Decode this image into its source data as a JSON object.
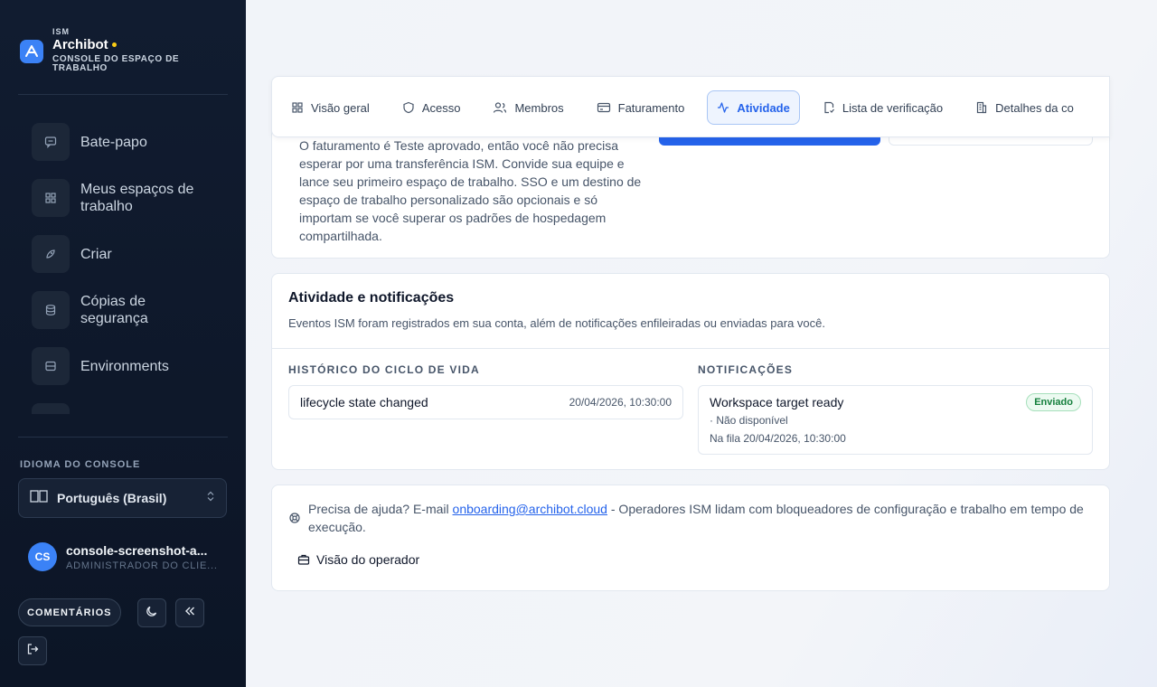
{
  "brand": {
    "kicker": "ISM",
    "name": "Archibot",
    "subtitle": "CONSOLE DO ESPAÇO DE TRABALHO"
  },
  "sidebar": {
    "items": [
      {
        "label": "Bate-papo",
        "icon": "chat-icon"
      },
      {
        "label": "Meus espaços de trabalho",
        "icon": "grid-icon"
      },
      {
        "label": "Criar",
        "icon": "rocket-icon"
      },
      {
        "label": "Cópias de segurança",
        "icon": "database-icon"
      },
      {
        "label": "Environments",
        "icon": "server-icon"
      }
    ],
    "language_title": "IDIOMA DO CONSOLE",
    "language_value": "Português (Brasil)",
    "user": {
      "initials": "CS",
      "name": "console-screenshot-a...",
      "role": "ADMINISTRADOR DO CLIE..."
    },
    "feedback_label": "COMENTÁRIOS"
  },
  "tabs": [
    {
      "label": "Visão geral",
      "icon": "grid-icon",
      "active": false
    },
    {
      "label": "Acesso",
      "icon": "shield-icon",
      "active": false
    },
    {
      "label": "Membros",
      "icon": "users-icon",
      "active": false
    },
    {
      "label": "Faturamento",
      "icon": "credit-card-icon",
      "active": false
    },
    {
      "label": "Atividade",
      "icon": "activity-icon",
      "active": true
    },
    {
      "label": "Lista de verificação",
      "icon": "checklist-icon",
      "active": false
    },
    {
      "label": "Detalhes da co",
      "icon": "building-icon",
      "active": false
    }
  ],
  "intro": {
    "text": "O faturamento é Teste aprovado, então você não precisa esperar por uma transferência ISM. Convide sua equipe e lance seu primeiro espaço de trabalho. SSO e um destino de espaço de trabalho personalizado são opcionais e só importam se você superar os padrões de hospedagem compartilhada."
  },
  "activity": {
    "title": "Atividade e notificações",
    "description": "Eventos ISM foram registrados em sua conta, além de notificações enfileiradas ou enviadas para você.",
    "lifecycle_title": "HISTÓRICO DO CICLO DE VIDA",
    "lifecycle_items": [
      {
        "label": "lifecycle state changed",
        "time": "20/04/2026, 10:30:00"
      }
    ],
    "notifications_title": "NOTIFICAÇÕES",
    "notifications": [
      {
        "title": "Workspace target ready",
        "status": "Enviado",
        "sub": "· Não disponível",
        "queued": "Na fila 20/04/2026, 10:30:00"
      }
    ]
  },
  "help": {
    "prefix": "Precisa de ajuda? E-mail",
    "email": "onboarding@archibot.cloud",
    "suffix": " - Operadores ISM lidam com bloqueadores de configuração e trabalho em tempo de execução.",
    "operator_label": "Visão do operador"
  },
  "colors": {
    "accent": "#2563eb",
    "sidebar_bg": "#111c30",
    "success": "#15803d",
    "brand_dot": "#facc15"
  }
}
